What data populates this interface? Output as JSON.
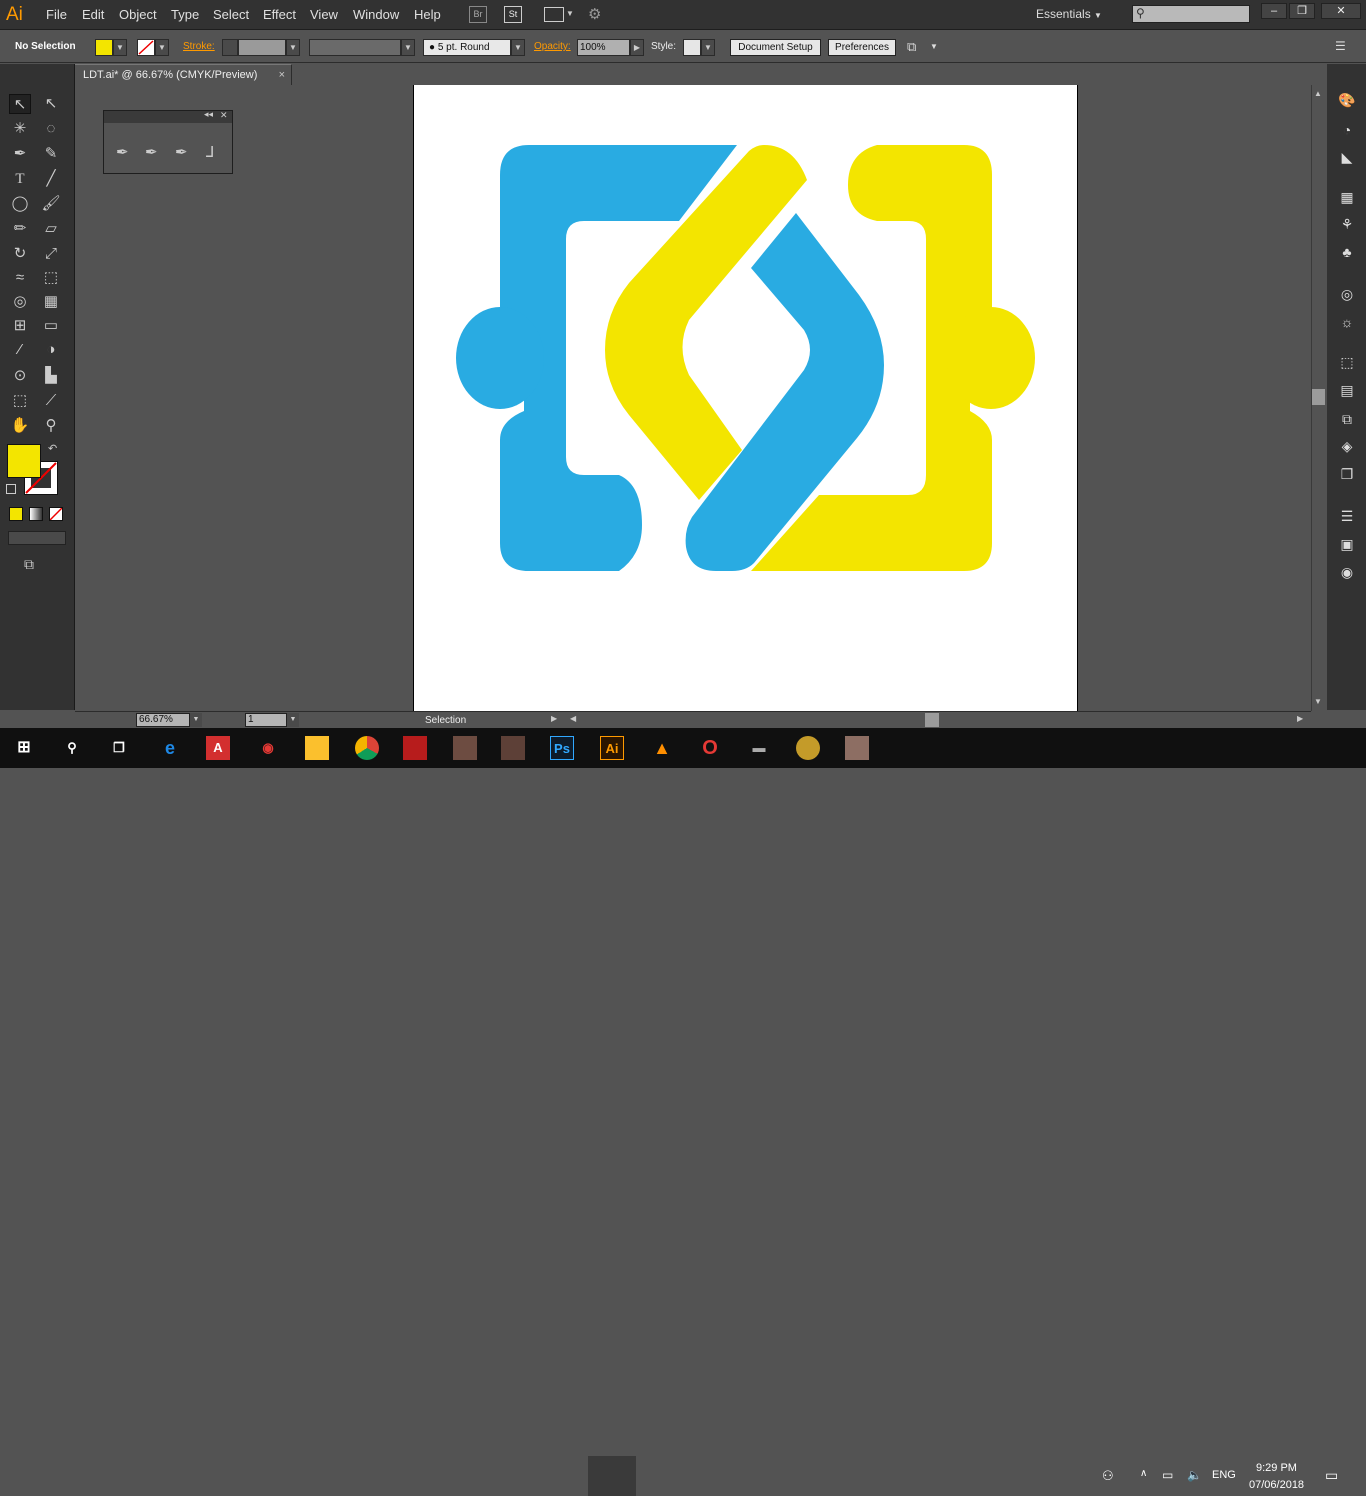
{
  "app": {
    "logo_text": "Ai",
    "workspace": "Essentials"
  },
  "menu": [
    "File",
    "Edit",
    "Object",
    "Type",
    "Select",
    "Effect",
    "View",
    "Window",
    "Help"
  ],
  "top_icons": [
    "Br",
    "St"
  ],
  "control_bar": {
    "selection": "No Selection",
    "stroke_label": "Stroke:",
    "brush": "5 pt. Round",
    "opacity_label": "Opacity:",
    "opacity_value": "100%",
    "style_label": "Style:",
    "document_setup": "Document Setup",
    "preferences": "Preferences"
  },
  "document_tab": {
    "title": "LDT.ai* @ 66.67% (CMYK/Preview)",
    "close": "×"
  },
  "status": {
    "zoom": "66.67%",
    "page": "1",
    "tool": "Selection"
  },
  "colors": {
    "blue": "#29abe2",
    "yellow": "#f3e500",
    "fill_swatch": "#f3e500"
  },
  "taskbar": {
    "time": "9:29 PM",
    "date": "07/06/2018",
    "lang": "ENG",
    "apps": [
      "ie-icon",
      "acrobat-icon",
      "media-icon",
      "explorer-icon",
      "chrome-icon",
      "dota-icon",
      "minecraft-icon",
      "game-icon",
      "photoshop-icon",
      "illustrator-icon",
      "vlc-icon",
      "opera-icon",
      "tank-icon",
      "game2-icon",
      "avatar-icon"
    ],
    "labels": {
      "ps": "Ps",
      "ai": "Ai",
      "acrobat": "A"
    }
  }
}
